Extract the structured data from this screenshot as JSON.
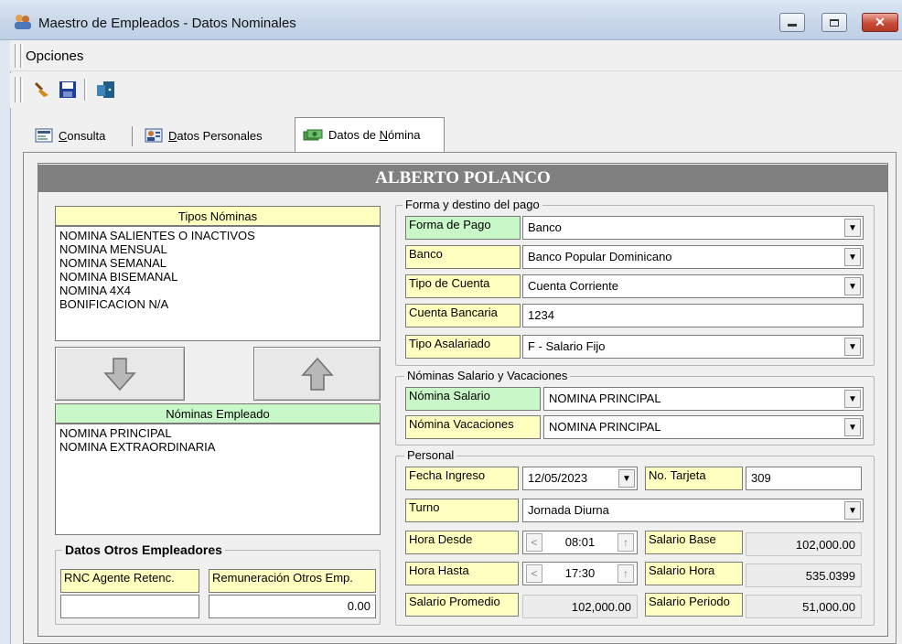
{
  "window": {
    "title": "Maestro de Empleados - Datos Nominales"
  },
  "menu": {
    "opciones": "Opciones"
  },
  "toolbar": {
    "icons": [
      "broom-icon",
      "save-icon",
      "exit-door-icon"
    ]
  },
  "tabs": [
    {
      "prefix": "",
      "u": "C",
      "suffix": "onsulta"
    },
    {
      "prefix": "",
      "u": "D",
      "suffix": "atos Personales"
    },
    {
      "prefix": "Datos de ",
      "u": "N",
      "suffix": "ómina"
    }
  ],
  "employee_name": "ALBERTO POLANCO",
  "tipos_nominas": {
    "header": "Tipos Nóminas",
    "items": [
      "NOMINA SALIENTES O INACTIVOS",
      "NOMINA MENSUAL",
      "NOMINA SEMANAL",
      "NOMINA BISEMANAL",
      "NOMINA 4X4",
      "BONIFICACION N/A"
    ]
  },
  "nominas_empleado": {
    "header": "Nóminas Empleado",
    "items": [
      "NOMINA PRINCIPAL",
      "NOMINA EXTRAORDINARIA"
    ]
  },
  "otros_empleadores": {
    "title": "Datos Otros Empleadores",
    "rnc_label": "RNC Agente Retenc.",
    "rnc_value": "",
    "remuneracion_label": "Remuneración Otros Emp.",
    "remuneracion_value": "0.00"
  },
  "forma_destino": {
    "legend": "Forma y destino del pago",
    "forma_pago_label": "Forma de Pago",
    "forma_pago": "Banco",
    "banco_label": "Banco",
    "banco": "Banco Popular Dominicano",
    "tipo_cuenta_label": "Tipo de Cuenta",
    "tipo_cuenta": "Cuenta Corriente",
    "cuenta_label": "Cuenta Bancaria",
    "cuenta": "1234",
    "tipo_asalariado_label": "Tipo Asalariado",
    "tipo_asalariado": "F - Salario Fijo"
  },
  "nominas_sv": {
    "legend": "Nóminas Salario y Vacaciones",
    "salario_label": "Nómina Salario",
    "salario": "NOMINA PRINCIPAL",
    "vacaciones_label": "Nómina Vacaciones",
    "vacaciones": "NOMINA PRINCIPAL"
  },
  "personal": {
    "legend": "Personal",
    "fecha_label": "Fecha Ingreso",
    "fecha": "12/05/2023",
    "tarjeta_label": "No. Tarjeta",
    "tarjeta": "309",
    "turno_label": "Turno",
    "turno": "Jornada Diurna",
    "hora_desde_label": "Hora Desde",
    "hora_desde": "08:01",
    "hora_hasta_label": "Hora Hasta",
    "hora_hasta": "17:30",
    "salario_base_label": "Salario Base",
    "salario_base": "102,000.00",
    "salario_hora_label": "Salario Hora",
    "salario_hora": "535.0399",
    "salario_promedio_label": "Salario Promedio",
    "salario_promedio": "102,000.00",
    "salario_periodo_label": "Salario Periodo",
    "salario_periodo": "51,000.00"
  }
}
